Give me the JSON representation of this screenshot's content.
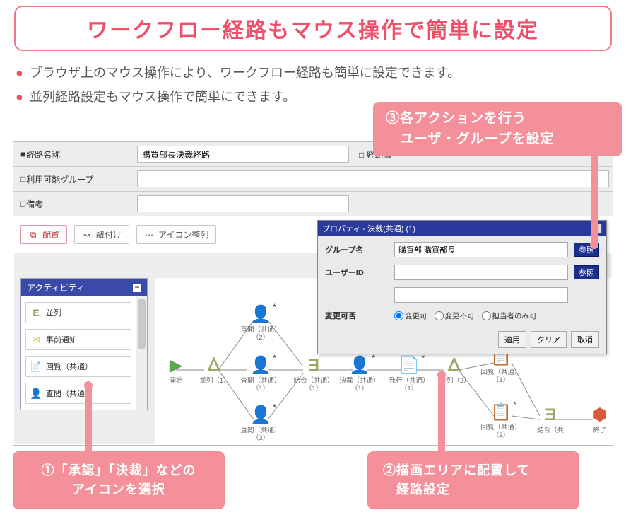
{
  "title": "ワークフロー経路もマウス操作で簡単に設定",
  "bullets": [
    "ブラウザ上のマウス操作により、ワークフロー経路も簡単に設定できます。",
    "並列経路設定もマウス操作で簡単にできます。"
  ],
  "form": {
    "route_name_label": "経路名称",
    "route_name_value": "購買部長決裁経路",
    "route_comment_label": "経路コ",
    "group_label": "利用可能グループ",
    "group_value": "",
    "remarks_label": "備考",
    "remarks_value": ""
  },
  "toolbar": {
    "place": "配置",
    "link": "紐付け",
    "align": "アイコン整列"
  },
  "panel": {
    "title": "アクティビティ",
    "items": [
      {
        "icon": "E",
        "color": "#8aa36a",
        "label": "並列"
      },
      {
        "icon": "✉",
        "color": "#d4bf3a",
        "label": "事前通知"
      },
      {
        "icon": "📄",
        "color": "#9aa3ad",
        "label": "回覧（共通）"
      },
      {
        "icon": "👤",
        "color": "#3a77c2",
        "label": "査閲（共通）"
      }
    ]
  },
  "nodes": {
    "start": {
      "label": "開始"
    },
    "par1": {
      "label": "並列（1）"
    },
    "rev1": {
      "label": "査閲（共通）（1）"
    },
    "rev2": {
      "label": "直閲（共通）（2）"
    },
    "rev3": {
      "label": "直閲（共通）（3）"
    },
    "join": {
      "label": "結合（共通）（1）"
    },
    "decide": {
      "label": "決裁（共通）（1）"
    },
    "issue": {
      "label": "発行（共通）（1）"
    },
    "par2": {
      "label": "並列（2）"
    },
    "circ1": {
      "label": "回覧（共通）（1）"
    },
    "circ2": {
      "label": "回覧（共通）（2）"
    },
    "join2": {
      "label": "結合（共"
    },
    "end": {
      "label": "終了"
    }
  },
  "prop": {
    "header": "プロパティ - 決裁(共通) (1)",
    "group_label": "グループ名",
    "group_value": "購買部 購買部長",
    "user_label": "ユーザーID",
    "user_value": "",
    "user_value2": "",
    "ref": "参照",
    "change_label": "変更可否",
    "radio1": "変更可",
    "radio2": "変更不可",
    "radio3": "担当者のみ可",
    "apply": "適用",
    "clear": "クリア",
    "cancel": "取消"
  },
  "callouts": {
    "c1a": "①「承認」「決裁」などの",
    "c1b": "アイコンを選択",
    "c2a": "②描画エリアに配置して",
    "c2b": "　経路設定",
    "c3a": "③各アクションを行う",
    "c3b": "　ユーザ・グループを設定"
  }
}
